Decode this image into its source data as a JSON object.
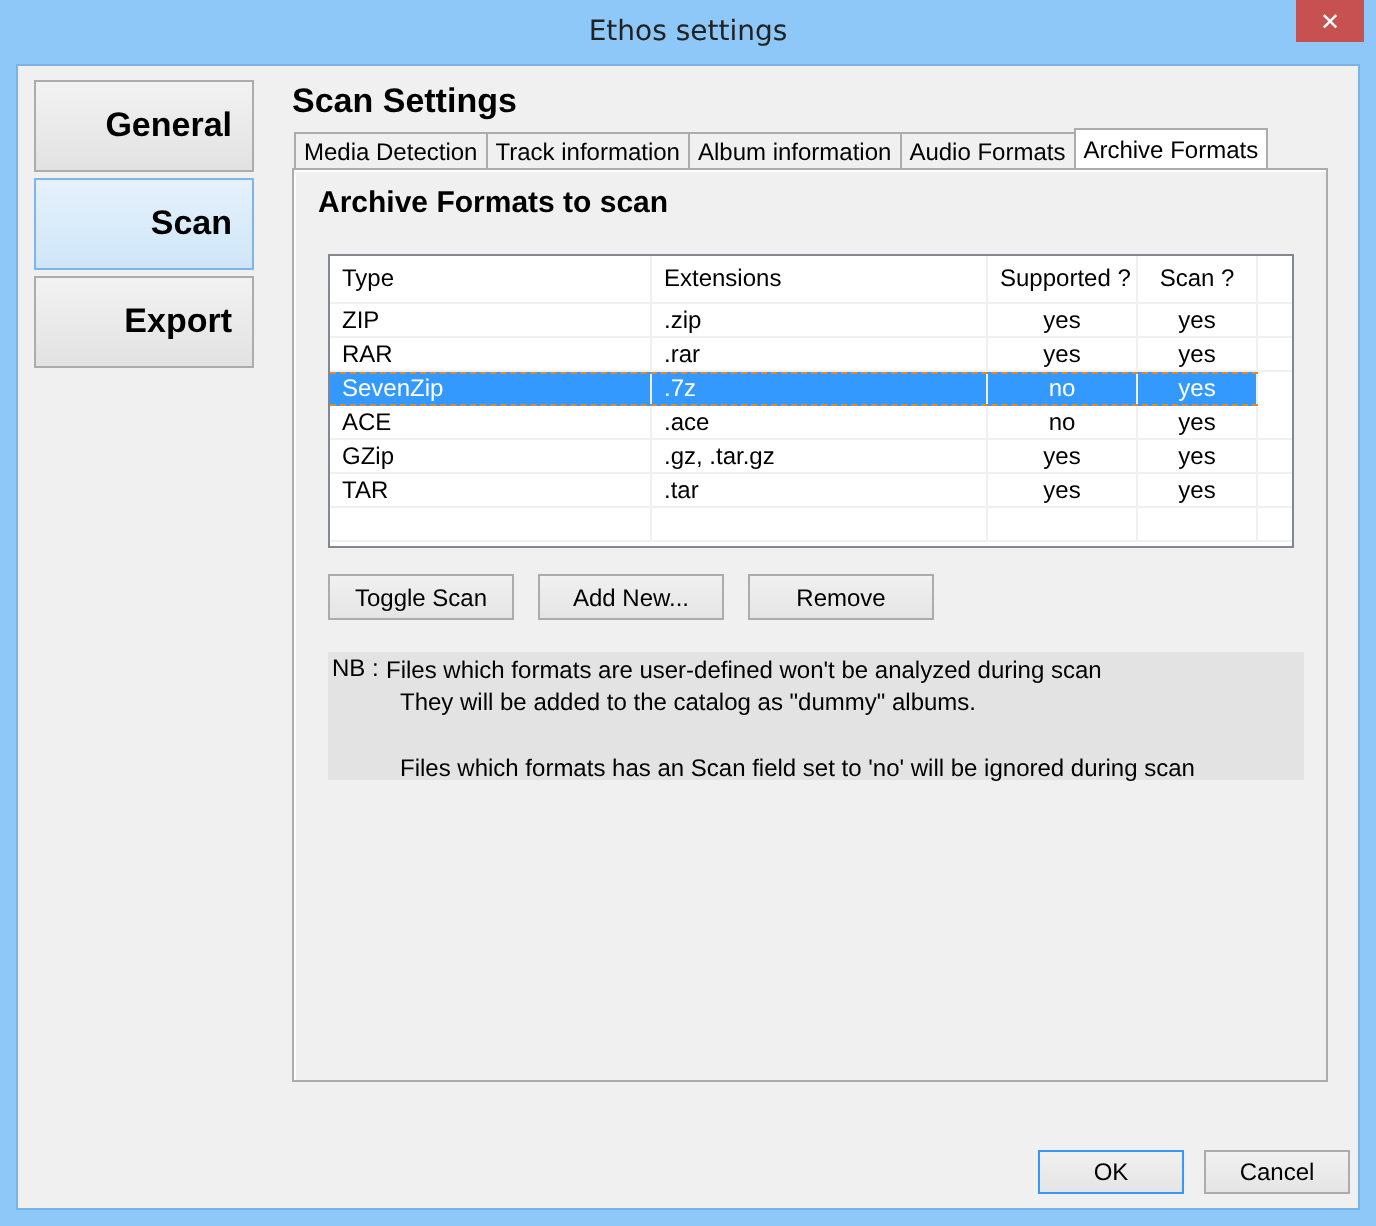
{
  "window": {
    "title": "Ethos settings",
    "close": "✕"
  },
  "sidebar": {
    "items": [
      {
        "label": "General",
        "selected": false
      },
      {
        "label": "Scan",
        "selected": true
      },
      {
        "label": "Export",
        "selected": false
      }
    ]
  },
  "heading": "Scan Settings",
  "tabs": [
    {
      "label": "Media Detection",
      "selected": false
    },
    {
      "label": "Track information",
      "selected": false
    },
    {
      "label": "Album information",
      "selected": false
    },
    {
      "label": "Audio Formats",
      "selected": false
    },
    {
      "label": "Archive Formats",
      "selected": true
    }
  ],
  "panel_title": "Archive Formats to scan",
  "table": {
    "columns": [
      "Type",
      "Extensions",
      "Supported ?",
      "Scan ?"
    ],
    "rows": [
      {
        "cells": [
          "ZIP",
          ".zip",
          "yes",
          "yes"
        ],
        "selected": false
      },
      {
        "cells": [
          "RAR",
          ".rar",
          "yes",
          "yes"
        ],
        "selected": false
      },
      {
        "cells": [
          "SevenZip",
          ".7z",
          "no",
          "yes"
        ],
        "selected": true
      },
      {
        "cells": [
          "ACE",
          ".ace",
          "no",
          "yes"
        ],
        "selected": false
      },
      {
        "cells": [
          "GZip",
          ".gz, .tar.gz",
          "yes",
          "yes"
        ],
        "selected": false
      },
      {
        "cells": [
          "TAR",
          ".tar",
          "yes",
          "yes"
        ],
        "selected": false
      }
    ]
  },
  "actions": [
    "Toggle Scan",
    "Add New...",
    "Remove"
  ],
  "note": {
    "label": "NB :",
    "paragraphs": [
      [
        "Files which formats are user-defined won't be analyzed during scan",
        "They will be added to the catalog as \"dummy\" albums."
      ],
      [
        "Files which formats has an Scan field set to 'no' will be ignored during scan"
      ]
    ]
  },
  "buttons": [
    {
      "label": "OK",
      "default": true
    },
    {
      "label": "Cancel",
      "default": false
    }
  ]
}
